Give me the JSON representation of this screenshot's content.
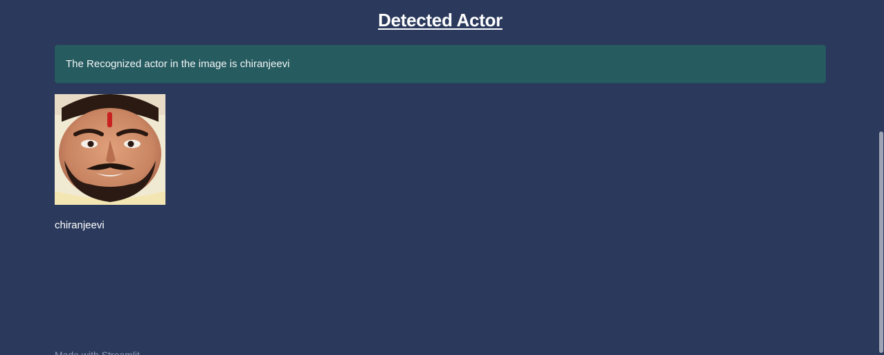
{
  "page": {
    "title": "Detected Actor",
    "alert_text": "The Recognized actor in the image is chiranjeevi",
    "image_caption": "chiranjeevi",
    "footer_text": "Made with Streamlit"
  },
  "colors": {
    "background": "#2b3a5c",
    "alert_background": "#265b60",
    "text": "#ffffff"
  },
  "icons": {
    "actor_image": "actor-face-photo"
  }
}
